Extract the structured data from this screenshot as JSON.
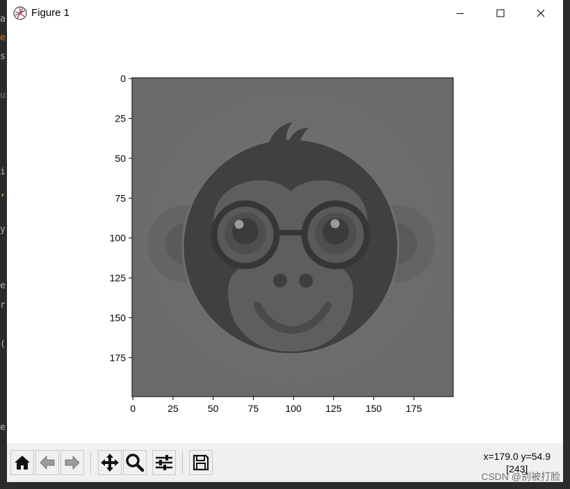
{
  "background_editor": {
    "visible_chars": [
      {
        "text": "a",
        "color": "default"
      },
      {
        "text": "e",
        "color": "orange"
      },
      {
        "text": "s",
        "color": "default"
      },
      {
        "text": "u",
        "color": "green"
      },
      {
        "text": "i",
        "color": "default"
      },
      {
        "text": ",",
        "color": "yellow"
      },
      {
        "text": "y",
        "color": "default"
      },
      {
        "text": "e",
        "color": "default"
      },
      {
        "text": "r",
        "color": "default"
      },
      {
        "text": "(",
        "color": "default"
      },
      {
        "text": "e",
        "color": "default"
      }
    ]
  },
  "window": {
    "title": "Figure 1",
    "controls": {
      "minimize": "minimize-icon",
      "maximize": "maximize-icon",
      "close": "close-icon"
    }
  },
  "figure": {
    "image_description": "grayscale monkey face with round glasses",
    "x_ticks": [
      "0",
      "25",
      "50",
      "75",
      "100",
      "125",
      "150",
      "175"
    ],
    "y_ticks": [
      "0",
      "25",
      "50",
      "75",
      "100",
      "125",
      "150",
      "175"
    ],
    "x_range": [
      0,
      199
    ],
    "y_range": [
      0,
      199
    ],
    "y_inverted": true
  },
  "toolbar": {
    "buttons": [
      {
        "name": "home",
        "icon": "home-icon"
      },
      {
        "name": "back",
        "icon": "back-arrow-icon"
      },
      {
        "name": "forward",
        "icon": "forward-arrow-icon"
      },
      {
        "name": "pan",
        "icon": "move-icon"
      },
      {
        "name": "zoom",
        "icon": "magnifier-icon"
      },
      {
        "name": "configure",
        "icon": "sliders-icon"
      },
      {
        "name": "save",
        "icon": "floppy-icon"
      }
    ],
    "coordinates": "x=179.0 y=54.9",
    "pixel_value": "[243]"
  },
  "watermark": "CSDN @别被打脸",
  "colors": {
    "window_bg": "#ffffff",
    "toolbar_bg": "#f0f0f0",
    "image_bg": "#6e6e6e",
    "image_dark": "#3f3f3f",
    "image_mid": "#5e5e5e"
  }
}
